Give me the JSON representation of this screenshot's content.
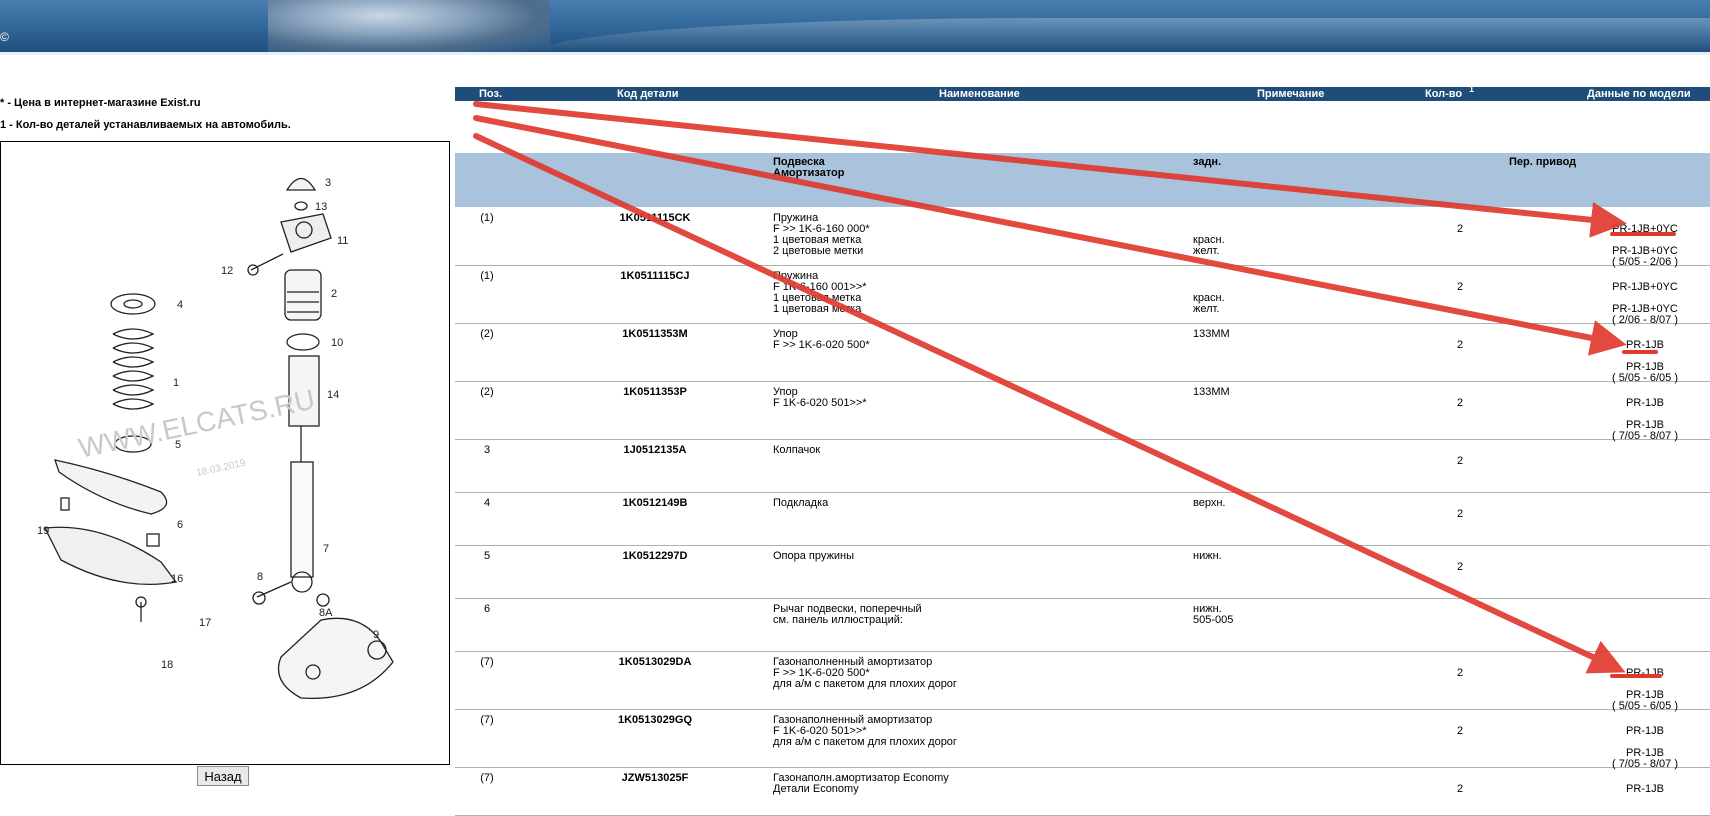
{
  "legend": {
    "price_note": "* - Цена в интернет-магазине Exist.ru",
    "qty_note": "1 - Кол-во деталей устанавливаемых на автомобиль."
  },
  "header": {
    "pos": "Поз.",
    "code": "Код детали",
    "name": "Наименование",
    "note": "Примечание",
    "qty": "Кол-во",
    "qty_sup": "1",
    "model": "Данные по модели"
  },
  "group": {
    "name_line1": "Подвеска",
    "name_line2": "Амортизатор",
    "note": "задн.",
    "model": "Пер. привод"
  },
  "rows": [
    {
      "pos": "(1)",
      "code": "1K0511115CK",
      "name": "Пружина\nF >> 1K-6-160 000*\n1 цветовая метка\n2 цветовые метки",
      "note": "\n\nкрасн.\nжелт.",
      "qty": "2",
      "model": "PR-1JB+0YC\n\nPR-1JB+0YC\n( 5/05 - 2/06 )"
    },
    {
      "pos": "(1)",
      "code": "1K0511115CJ",
      "name": "Пружина\nF 1K-6-160 001>>*\n1 цветовая метка\n1 цветовая метка",
      "note": "\n\nкрасн.\nжелт.",
      "qty": "2",
      "model": "PR-1JB+0YC\n\nPR-1JB+0YC\n( 2/06 - 8/07 )"
    },
    {
      "pos": "(2)",
      "code": "1K0511353M",
      "name": "Упор\nF >> 1K-6-020 500*",
      "note": "133MM",
      "qty": "2",
      "model": "PR-1JB\n\nPR-1JB\n( 5/05 - 6/05 )"
    },
    {
      "pos": "(2)",
      "code": "1K0511353P",
      "name": "Упор\nF 1K-6-020 501>>*",
      "note": "133MM",
      "qty": "2",
      "model": "PR-1JB\n\nPR-1JB\n( 7/05 - 8/07 )"
    },
    {
      "pos": "3",
      "code": "1J0512135A",
      "name": "Колпачок",
      "note": "",
      "qty": "2",
      "model": ""
    },
    {
      "pos": "4",
      "code": "1K0512149B",
      "name": "Подкладка",
      "note": "верхн.",
      "qty": "2",
      "model": ""
    },
    {
      "pos": "5",
      "code": "1K0512297D",
      "name": "Опора пружины",
      "note": "нижн.",
      "qty": "2",
      "model": ""
    },
    {
      "pos": "6",
      "code": "",
      "name": "Рычаг подвески, поперечный\nсм. панель иллюстраций:",
      "note": "нижн.\n505-005",
      "qty": "",
      "model": ""
    },
    {
      "pos": "(7)",
      "code": "1K0513029DA",
      "name": "Газонаполненный амортизатор\nF >> 1K-6-020 500*\nдля а/м с пакетом для плохих дорог",
      "note": "",
      "qty": "2",
      "model": "PR-1JB\n\nPR-1JB\n( 5/05 - 6/05 )"
    },
    {
      "pos": "(7)",
      "code": "1K0513029GQ",
      "name": "Газонаполненный амортизатор\nF 1K-6-020 501>>*\nдля а/м с пакетом для плохих дорог",
      "note": "",
      "qty": "2",
      "model": "PR-1JB\n\nPR-1JB\n( 7/05 - 8/07 )"
    },
    {
      "pos": "(7)",
      "code": "JZW513025F",
      "name": "Газонаполн.амортизатор Economy\nДетали Economy",
      "note": "",
      "qty": "2",
      "model": "PR-1JB"
    }
  ],
  "diagram": {
    "watermark": "WWW.ELCATS.RU",
    "watermark_date": "18.03.2019",
    "callouts": [
      "3",
      "13",
      "11",
      "12",
      "2",
      "10",
      "14",
      "4",
      "1",
      "5",
      "7",
      "6",
      "19",
      "16",
      "17",
      "18",
      "8",
      "8A",
      "9"
    ]
  },
  "back_button": "Назад",
  "colors": {
    "header_bg": "#1f4d7a",
    "group_bg": "#a9c3dc",
    "annotation": "#e03a2f"
  }
}
